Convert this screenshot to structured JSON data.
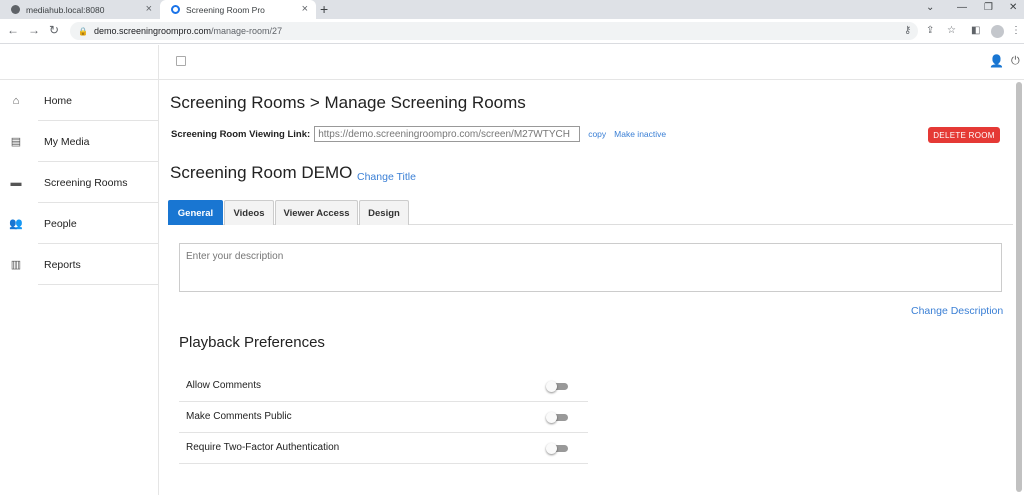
{
  "browser": {
    "tabs": [
      {
        "title": "mediahub.local:8080"
      },
      {
        "title": "Screening Room Pro"
      }
    ],
    "url_host": "demo.screeningroompro.com",
    "url_path": "/manage-room/27"
  },
  "sidebar": {
    "items": [
      {
        "label": "Home",
        "icon": "home-icon"
      },
      {
        "label": "My Media",
        "icon": "film-icon"
      },
      {
        "label": "Screening Rooms",
        "icon": "folder-icon"
      },
      {
        "label": "People",
        "icon": "people-icon"
      },
      {
        "label": "Reports",
        "icon": "bar-chart-icon"
      }
    ]
  },
  "page": {
    "breadcrumb": "Screening Rooms > Manage Screening Rooms",
    "link_label": "Screening Room Viewing Link:",
    "link_value": "https://demo.screeningroompro.com/screen/M27WTYCH",
    "copy_label": "copy",
    "make_inactive_label": "Make inactive",
    "delete_label": "DELETE ROOM",
    "room_title": "Screening Room DEMO",
    "change_title_label": "Change Title",
    "tabs": [
      {
        "label": "General"
      },
      {
        "label": "Videos"
      },
      {
        "label": "Viewer Access"
      },
      {
        "label": "Design"
      }
    ],
    "description_placeholder": "Enter your description",
    "change_description_label": "Change Description",
    "playback_heading": "Playback Preferences",
    "preferences": [
      {
        "label": "Allow Comments",
        "enabled": false
      },
      {
        "label": "Make Comments Public",
        "enabled": false
      },
      {
        "label": "Require Two-Factor Authentication",
        "enabled": false
      }
    ]
  },
  "colors": {
    "accent": "#1976d2",
    "link": "#3a7fd5",
    "danger": "#e53935"
  }
}
